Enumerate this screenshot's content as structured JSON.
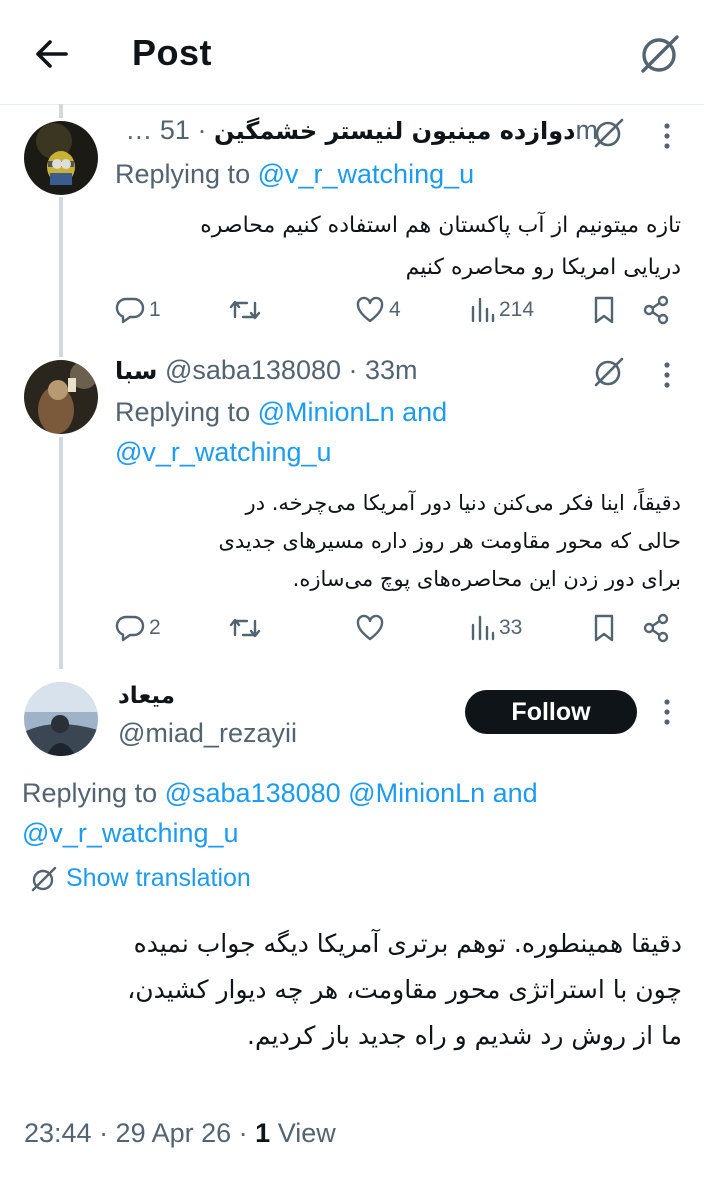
{
  "header": {
    "title": "Post"
  },
  "replies": [
    {
      "display_name": "دوازده مینیون لنیستر خشمگین",
      "name_ellipsis": "…",
      "time": "· 51m",
      "replying_label": "Replying to",
      "replying_to": "@v_r_watching_u",
      "text_lines": [
        "تازه میتونیم از آب پاکستان هم استفاده کنیم محاصره",
        "دریایی امریکا رو محاصره کنیم"
      ],
      "stats": {
        "replies": "1",
        "reposts": "",
        "likes": "4",
        "views": "214"
      }
    },
    {
      "display_name": "سبا",
      "handle_time": "@saba138080 · 33m",
      "replying_label": "Replying to",
      "replying_to": "@MinionLn and",
      "replying_to_2": "@v_r_watching_u",
      "text_lines": [
        "دقیقاً، اینا فکر می‌کنن دنیا دور آمریکا می‌چرخه. در",
        "حالی که محور مقاومت هر روز داره مسیرهای جدیدی",
        "برای دور زدن این محاصره‌های پوچ می‌سازه."
      ],
      "stats": {
        "replies": "2",
        "reposts": "",
        "likes": "",
        "views": "33"
      }
    }
  ],
  "main_post": {
    "display_name": "میعاد",
    "handle": "@miad_rezayii",
    "follow_label": "Follow",
    "replying_label": "Replying to",
    "replying_to": "@saba138080 @MinionLn and",
    "replying_to_2": "@v_r_watching_u",
    "translate_label": "Show translation",
    "text_lines": [
      "دقیقا همینطوره. توهم برتری آمریکا دیگه جواب نمیده",
      "چون با استراتژی محور مقاومت، هر چه دیوار کشیدن،",
      "ما از روش رد شدیم و راه جدید باز کردیم."
    ],
    "timestamp": "23:44 · 29 Apr 26 · ",
    "views_count": "1",
    "views_label": "View"
  },
  "icons": {
    "back": "arrow-left-icon",
    "grok": "grok-icon",
    "more": "more-vertical-icon",
    "reply": "reply-icon",
    "repost": "repost-icon",
    "like": "heart-icon",
    "views": "views-chart-icon",
    "bookmark": "bookmark-icon",
    "share": "share-icon",
    "translate": "translate-icon"
  },
  "colors": {
    "link": "#1d9bf0",
    "muted": "#536471",
    "text": "#0f1419",
    "follow_bg": "#0f1419"
  }
}
